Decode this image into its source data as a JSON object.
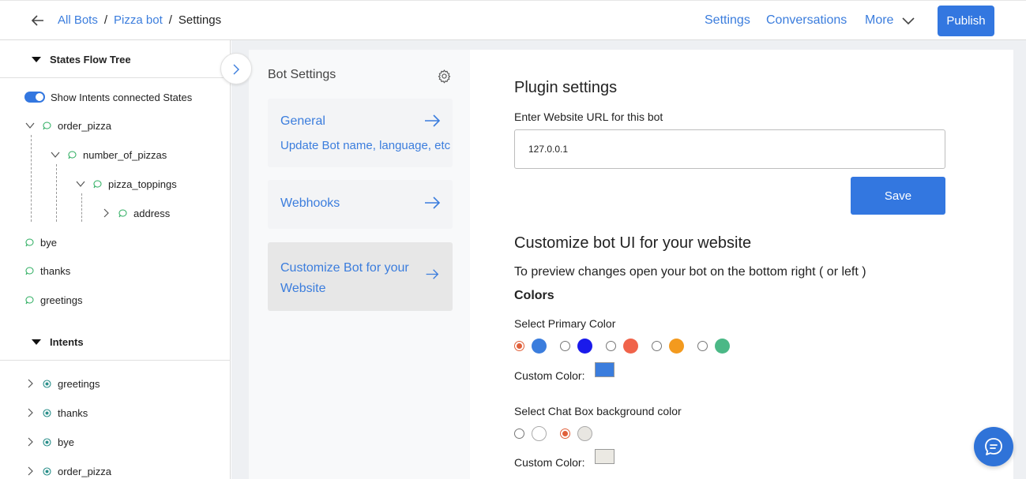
{
  "header": {
    "breadcrumb": [
      "All Bots",
      "Pizza bot",
      "Settings"
    ],
    "nav": {
      "settings": "Settings",
      "conversations": "Conversations",
      "more": "More"
    },
    "publish_label": "Publish"
  },
  "sidebar": {
    "states_title": "States Flow Tree",
    "show_intents_label": "Show Intents connected States",
    "show_intents_on": true,
    "states": [
      "order_pizza",
      "number_of_pizzas",
      "pizza_toppings",
      "address",
      "bye",
      "thanks",
      "greetings"
    ],
    "intents_title": "Intents",
    "intents": [
      "greetings",
      "thanks",
      "bye",
      "order_pizza"
    ]
  },
  "bot_settings": {
    "title": "Bot Settings",
    "tiles": [
      {
        "title": "General",
        "subtitle": "Update Bot name, language, etc"
      },
      {
        "title": "Webhooks",
        "subtitle": ""
      },
      {
        "title": "Customize Bot for your Website",
        "subtitle": ""
      }
    ],
    "active_tile": 2
  },
  "plugin": {
    "heading": "Plugin settings",
    "url_label": "Enter Website URL for this bot",
    "url_value": "127.0.0.1",
    "save_label": "Save"
  },
  "customize": {
    "heading": "Customize bot UI for your website",
    "preview_text": "To preview changes open your bot on the bottom right ( or left )",
    "colors_heading": "Colors",
    "primary_label": "Select Primary Color",
    "primary_colors": [
      "#3b7ddd",
      "#1a1aeb",
      "#f0634a",
      "#f39a1e",
      "#4bb886"
    ],
    "primary_selected": 0,
    "custom_color_label": "Custom Color:",
    "primary_custom": "#3b7ddd",
    "chatbox_label": "Select Chat Box background color",
    "chatbox_colors": [
      "#ffffff",
      "#e8e6e1"
    ],
    "chatbox_selected": 1,
    "chatbox_custom": "#ebe9e3"
  }
}
